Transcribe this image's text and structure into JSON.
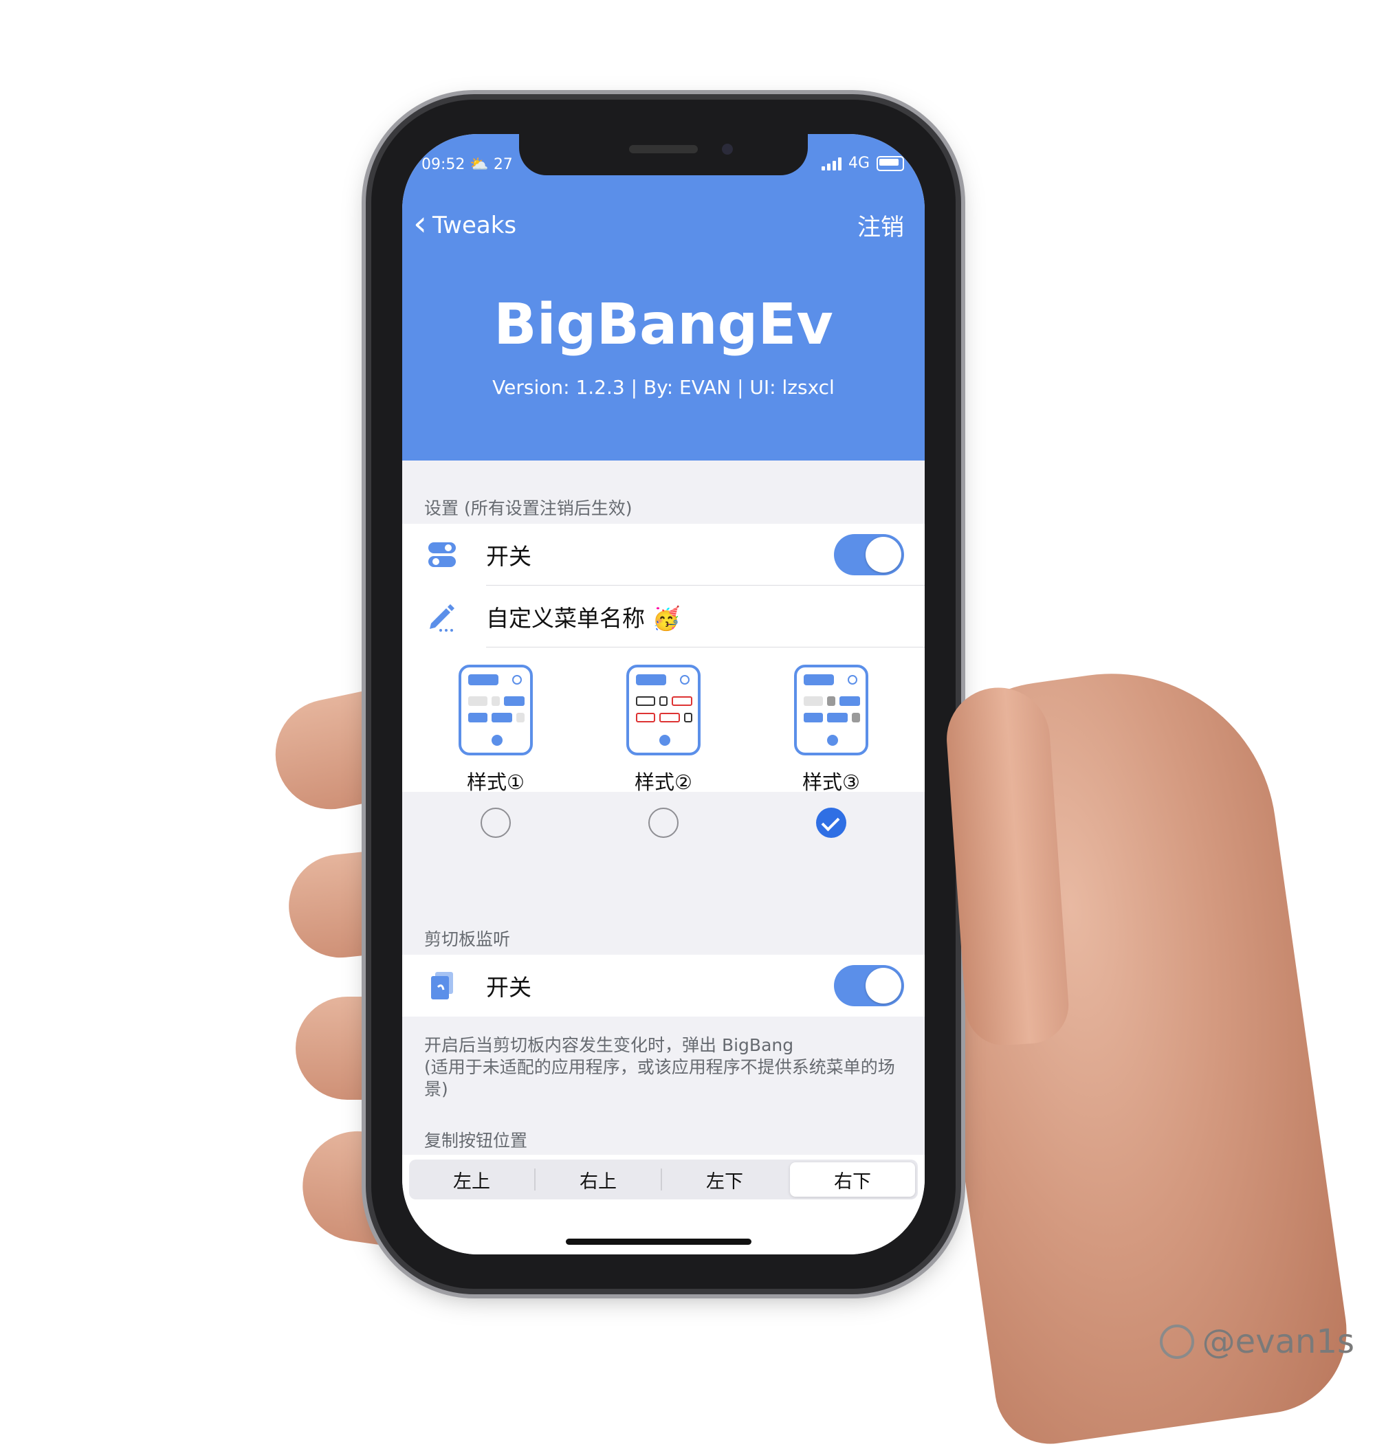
{
  "status_bar": {
    "time": "09:52",
    "weather_icon": "cloud-sun-icon",
    "temperature": "27",
    "network": "4G"
  },
  "nav": {
    "back_label": "Tweaks",
    "logout_label": "注销"
  },
  "app": {
    "title": "BigBangEv",
    "subtitle": "Version: 1.2.3 | By: EVAN | UI: lzsxcl"
  },
  "settings": {
    "header": "设置 (所有设置注销后生效)",
    "switch_label": "开关",
    "switch_on": true,
    "custom_menu_label": "自定义菜单名称",
    "custom_menu_emoji": "🥳",
    "styles": [
      {
        "label": "样式①",
        "selected": false
      },
      {
        "label": "样式②",
        "selected": false
      },
      {
        "label": "样式③",
        "selected": true
      }
    ]
  },
  "clipboard": {
    "header": "剪切板监听",
    "switch_label": "开关",
    "switch_on": true,
    "description": "开启后当剪切板内容发生变化时，弹出 BigBang\n(适用于未适配的应用程序，或该应用程序不提供系统菜单的场景)"
  },
  "copy_button": {
    "header": "复制按钮位置",
    "options": [
      "左上",
      "右上",
      "左下",
      "右下"
    ],
    "selected": "右下"
  },
  "watermark": {
    "text": "@evan1s"
  },
  "colors": {
    "accent": "#5b8fe9",
    "check": "#2f6fe4",
    "background": "#f1f1f5"
  }
}
